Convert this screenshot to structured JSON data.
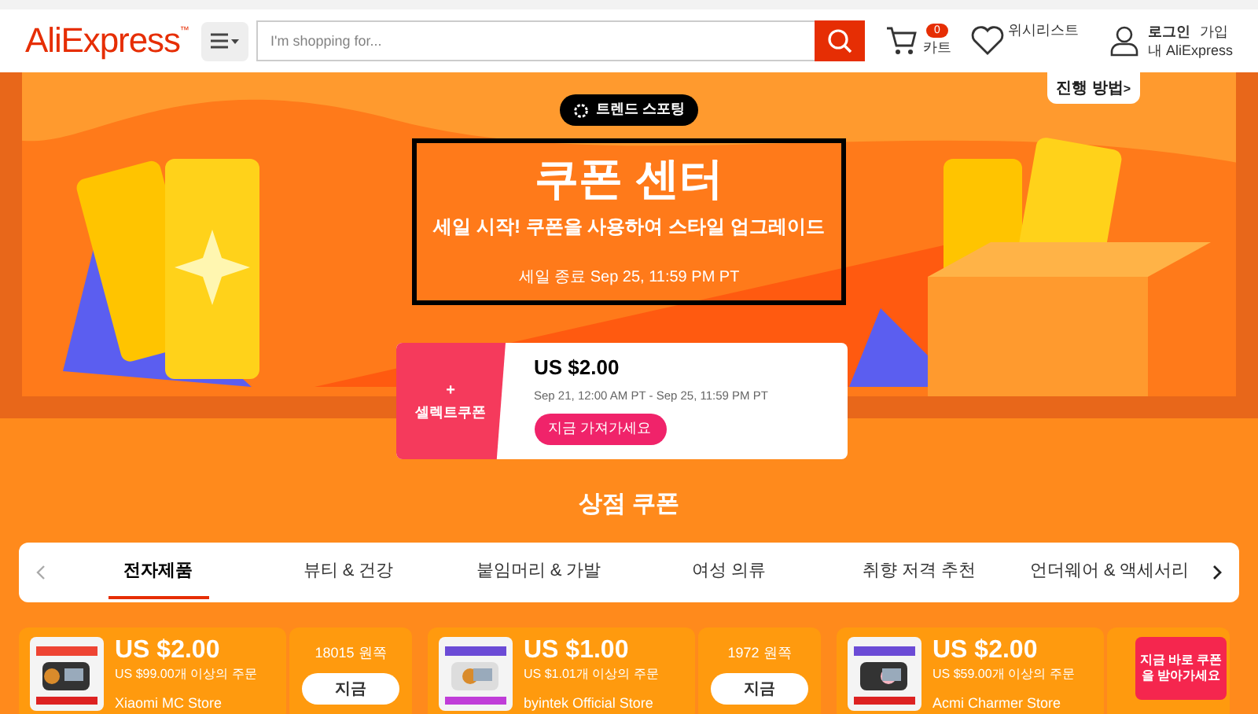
{
  "header": {
    "logo": "AliExpress",
    "logo_mark": "™",
    "search_placeholder": "I'm shopping for...",
    "cart_count": "0",
    "cart_label": "카트",
    "wishlist": "위시리스트",
    "login": "로그인",
    "signup": "가입",
    "account": "내 AliExpress"
  },
  "banner": {
    "badge": "트렌드 스포팅",
    "title": "쿠폰 센터",
    "subtitle": "세일 시작! 쿠폰을 사용하여 스타일 업그레이드",
    "end_text": "세일 종료 Sep 25, 11:59 PM PT",
    "how_to": "진행 방법",
    "how_to_arrow": ">"
  },
  "featured_coupon": {
    "plus": "+",
    "label": "셀렉트쿠폰",
    "amount": "US $2.00",
    "period": "Sep 21, 12:00 AM PT - Sep 25, 11:59 PM PT",
    "button": "지금 가져가세요"
  },
  "section_title": "상점 쿠폰",
  "tabs": [
    {
      "label": "전자제품",
      "selected": true
    },
    {
      "label": "뷰티 & 건강",
      "selected": false
    },
    {
      "label": "붙임머리 & 가발",
      "selected": false
    },
    {
      "label": "여성 의류",
      "selected": false
    },
    {
      "label": "취향 저격 추천",
      "selected": false
    },
    {
      "label": "언더웨어 & 액세서리",
      "selected": false
    }
  ],
  "store_coupons": [
    {
      "amount": "US $2.00",
      "condition": "US $99.00개 이상의 주문",
      "store": "Xiaomi MC Store",
      "remaining": "18015 원쪽",
      "button": "지금"
    },
    {
      "amount": "US $1.00",
      "condition": "US $1.01개 이상의 주문",
      "store": "byintek Official Store",
      "remaining": "1972 원쪽",
      "button": "지금"
    },
    {
      "amount": "US $2.00",
      "condition": "US $59.00개 이상의 주문",
      "store": "Acmi Charmer Store"
    }
  ],
  "promo_badge": "지금 바로 쿠폰을 받아가세요"
}
